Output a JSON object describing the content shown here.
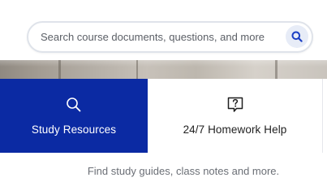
{
  "search": {
    "placeholder": "Search course documents, questions, and more",
    "icon": "search-icon"
  },
  "tabs": [
    {
      "label": "Study Resources",
      "icon": "search-icon",
      "active": true
    },
    {
      "label": "24/7 Homework Help",
      "icon": "question-bubble-icon",
      "active": false
    }
  ],
  "description": "Find study guides, class notes and more.",
  "colors": {
    "accent": "#0b2aa3",
    "search_icon": "#1b3fc4",
    "muted_text": "#6b6f76"
  }
}
